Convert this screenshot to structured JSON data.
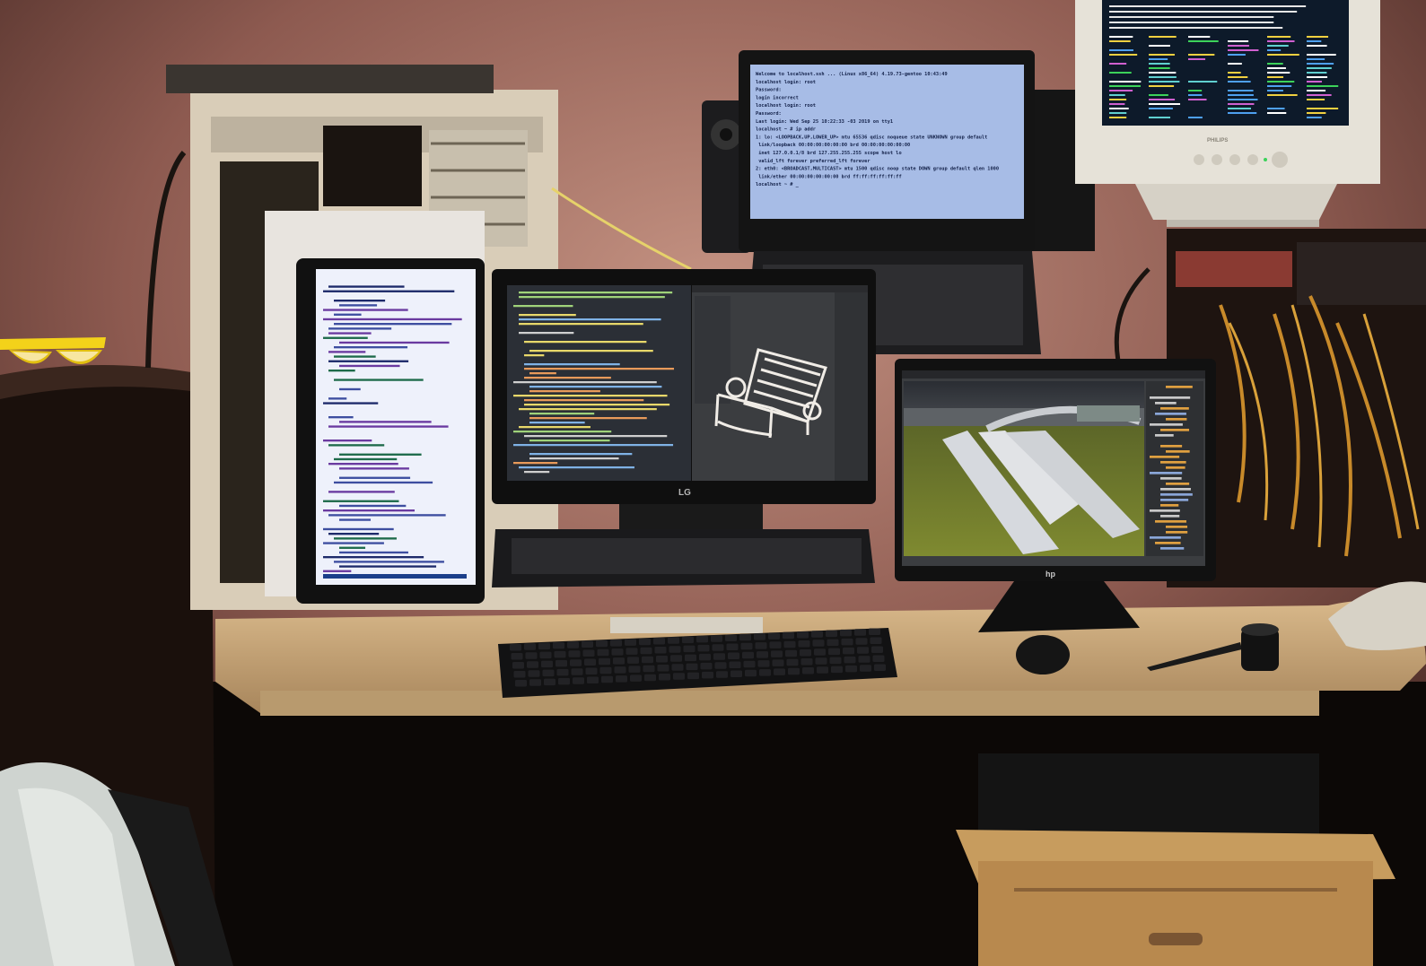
{
  "scene": {
    "description_free": true,
    "colors": {
      "wall": "#8a5a52",
      "wall_light": "#b88676",
      "desk": "#c9a77a",
      "desk_dark": "#3a2a1c",
      "terminal_bg": "#9fb4dc",
      "terminal_text": "#14224a",
      "editor_bg": "#2b2f36",
      "blender_bg": "#3b3d40",
      "grass": "#6f7a2a",
      "glasses": "#f3d21a",
      "crt_bg": "#0d1a2a"
    }
  },
  "monitors": {
    "top_terminal": {
      "lines": [
        "Welcome to localhost.ssh ... (Linux x86_64) 4.19.73-gentoo 10:43:49",
        "",
        "localhost login: root",
        "Password:",
        "",
        "login incorrect",
        "localhost login: root",
        "Password:",
        "Last login: Wed Sep 25 10:22:33 -03 2019 on tty1",
        "localhost ~ # ip addr",
        "1: lo: <LOOPBACK,UP,LOWER_UP> mtu 65536 qdisc noqueue state UNKNOWN group default",
        "    link/loopback 00:00:00:00:00:00 brd 00:00:00:00:00:00",
        "    inet 127.0.0.1/8 brd 127.255.255.255 scope host lo",
        "       valid_lft forever preferred_lft forever",
        "2: eth0: <BROADCAST,MULTICAST> mtu 1500 qdisc noop state DOWN group default qlen 1000",
        "    link/ether 00:00:00:00:00:00 brd ff:ff:ff:ff:ff:ff",
        "localhost ~ # _"
      ]
    },
    "center_lg": {
      "brand": "LG"
    },
    "right_hp": {
      "brand": "hp"
    },
    "crt": {
      "brand": "PHILIPS"
    }
  }
}
